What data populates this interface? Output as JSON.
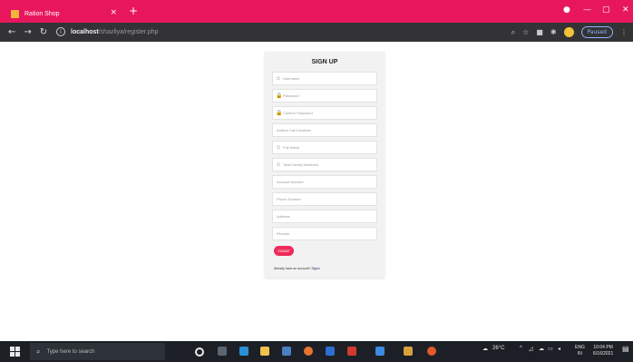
{
  "browser": {
    "tab_title": "Ration Shop",
    "tab_close": "×",
    "new_tab": "+",
    "minimize": "—",
    "maximize": "▢",
    "close": "✕",
    "url_host": "localhost",
    "url_path": "/shazliya/register.php",
    "profile_status": "Paused"
  },
  "form": {
    "title": "SIGN UP",
    "fields": [
      {
        "placeholder": "Username",
        "icon": "user-icon"
      },
      {
        "placeholder": "Password",
        "icon": "lock-icon"
      },
      {
        "placeholder": "Confirm Password",
        "icon": "lock-icon"
      },
      {
        "placeholder": "Aadhar Card Number",
        "icon": ""
      },
      {
        "placeholder": "Full Name",
        "icon": "user-icon"
      },
      {
        "placeholder": "Total Family Members",
        "icon": "user-icon"
      },
      {
        "placeholder": "Account Number",
        "icon": ""
      },
      {
        "placeholder": "Phone Number",
        "icon": ""
      },
      {
        "placeholder": "Address",
        "icon": ""
      },
      {
        "placeholder": "Pincode",
        "icon": ""
      }
    ],
    "submit_label": "SUBMIT",
    "signin_prompt": "Already have an account? Sign",
    "signin_link": "in"
  },
  "taskbar": {
    "search_placeholder": "Type here to search",
    "weather": "26°C",
    "lang_1": "ENG",
    "lang_2": "IN",
    "time": "10:04 PM",
    "date": "6/16/2021"
  },
  "colors": {
    "accent": "#e8175d",
    "submit": "#ef2a5a",
    "card_bg": "#f2f2f2",
    "taskbar_bg": "#1c2026"
  }
}
